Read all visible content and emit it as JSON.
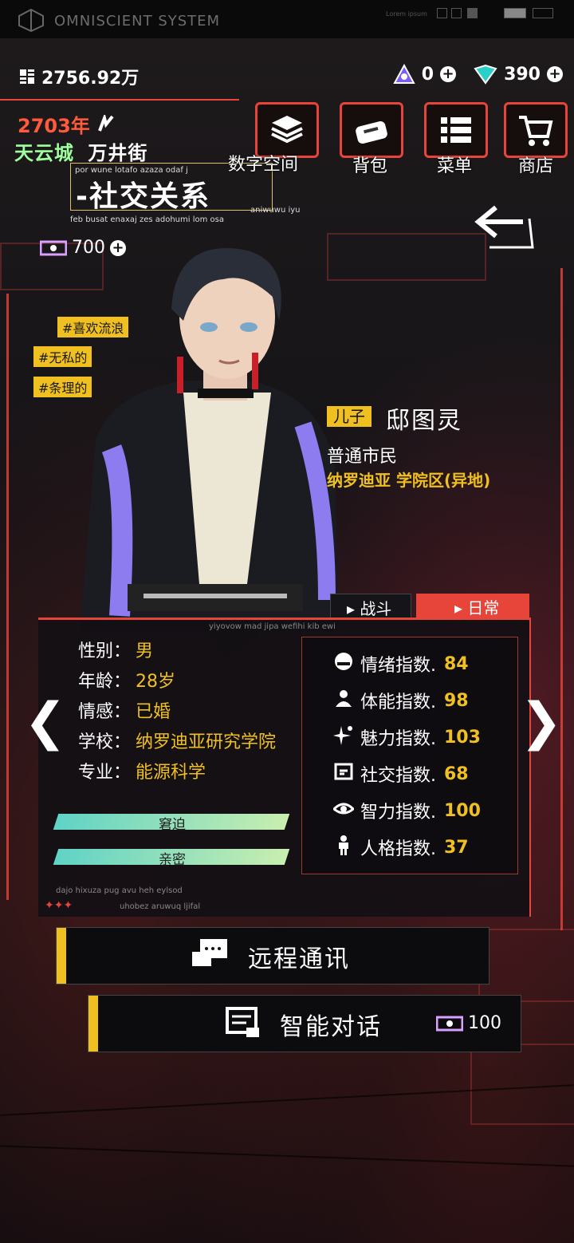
{
  "system": {
    "title": "OMNISCIENT SYSTEM",
    "lorem": "Lorem ipsum"
  },
  "currency": {
    "money": "2756.92万",
    "gem_a": "0",
    "gem_b": "390",
    "tickets": "700"
  },
  "location": {
    "year": "2703年",
    "city": "天云城",
    "street": "万井街",
    "section": "-社交关系",
    "tiny1": "por wune lotafo azaza odaf j",
    "tiny2": "feb busat enaxaj zes adohumi lom osa",
    "tiny3": "aniwuwu iyu"
  },
  "menu": [
    {
      "label": "数字空间"
    },
    {
      "label": "背包"
    },
    {
      "label": "菜单"
    },
    {
      "label": "商店"
    }
  ],
  "tags": [
    "#喜欢流浪",
    "#无私的",
    "#条理的"
  ],
  "character": {
    "relation": "儿子",
    "name": "邸图灵",
    "role": "普通市民",
    "location": "纳罗迪亚 学院区(异地)"
  },
  "tabs": {
    "battle": "战斗",
    "daily": "日常"
  },
  "panel_tiny": {
    "top": "yiyovow mad jipa wefihi kib ewi",
    "bottom1": "dajo hixuza pug avu heh eylsod",
    "bottom2": "uhobez aruwuq ljifal"
  },
  "attributes": [
    {
      "key": "性别：",
      "value": "男"
    },
    {
      "key": "年龄：",
      "value": "28岁"
    },
    {
      "key": "情感：",
      "value": "已婚"
    },
    {
      "key": "学校：",
      "value": "纳罗迪亚研究学院"
    },
    {
      "key": "专业：",
      "value": "能源科学"
    }
  ],
  "bars": [
    {
      "label": "窘迫"
    },
    {
      "label": "亲密"
    }
  ],
  "stats": [
    {
      "label": "情绪指数.",
      "value": "84",
      "icon": "emotion-icon"
    },
    {
      "label": "体能指数.",
      "value": "98",
      "icon": "stamina-icon"
    },
    {
      "label": "魅力指数.",
      "value": "103",
      "icon": "sparkle-icon"
    },
    {
      "label": "社交指数.",
      "value": "68",
      "icon": "social-icon"
    },
    {
      "label": "智力指数.",
      "value": "100",
      "icon": "eye-icon"
    },
    {
      "label": "人格指数.",
      "value": "37",
      "icon": "person-icon"
    }
  ],
  "actions": {
    "remote": "远程通讯",
    "chat": "智能对话",
    "chat_cost": "100"
  },
  "colors": {
    "accent": "#e8453a",
    "yellow": "#f0c020",
    "green": "#9dff9d"
  }
}
